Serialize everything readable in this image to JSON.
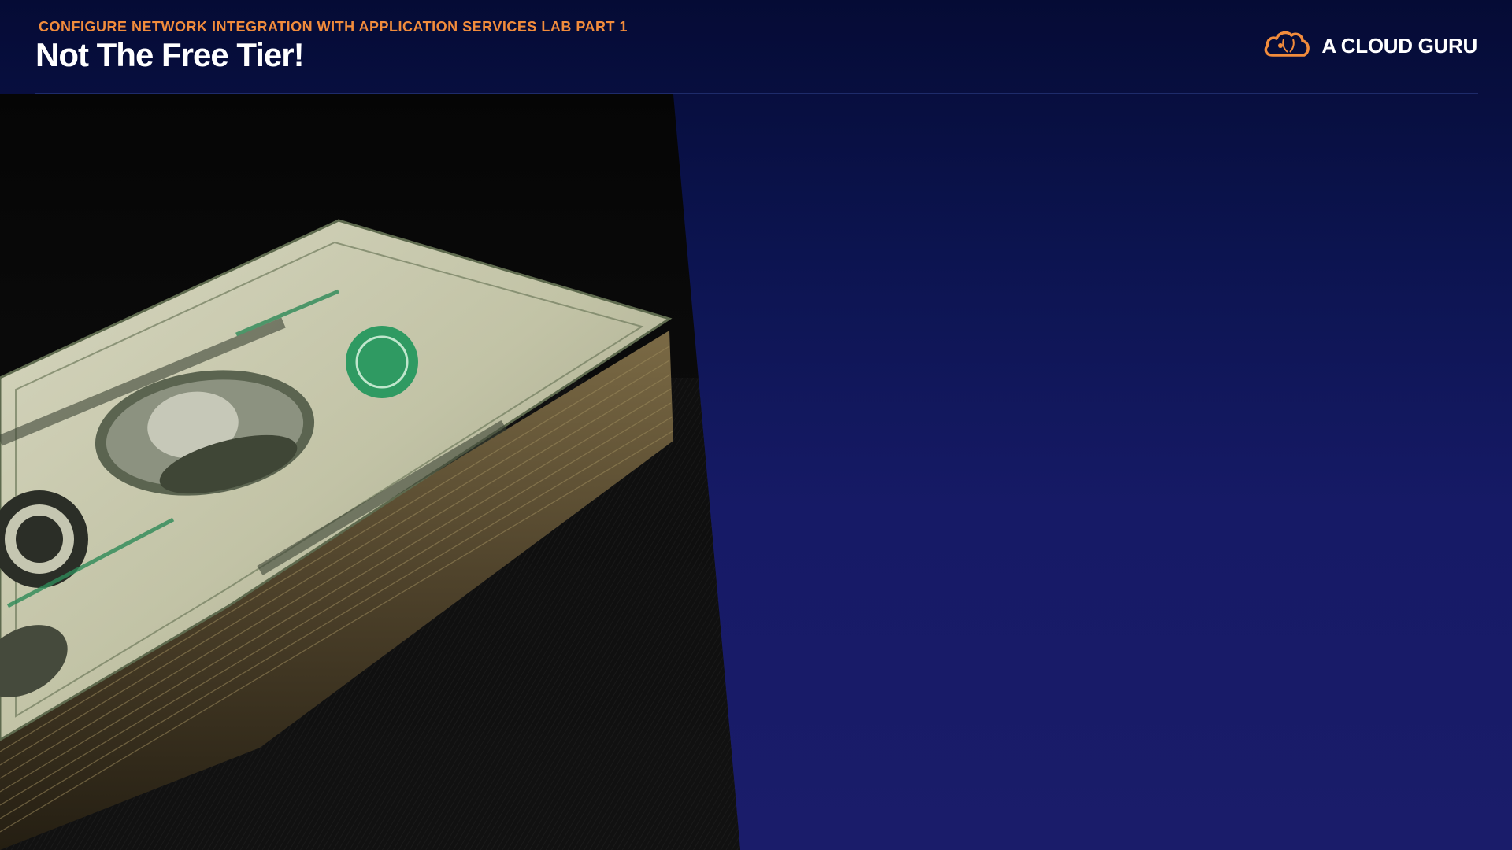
{
  "header": {
    "subtitle": "CONFIGURE NETWORK INTEGRATION WITH APPLICATION SERVICES LAB PART 1",
    "title": "Not The Free Tier!"
  },
  "brand": {
    "name": "A CLOUD GURU",
    "icon": "cloud-logo-icon"
  },
  "image": {
    "subject": "stack-of-dollar-bills"
  },
  "colors": {
    "accent": "#f28c3c",
    "background": "#0c1450",
    "title": "#ffffff"
  }
}
